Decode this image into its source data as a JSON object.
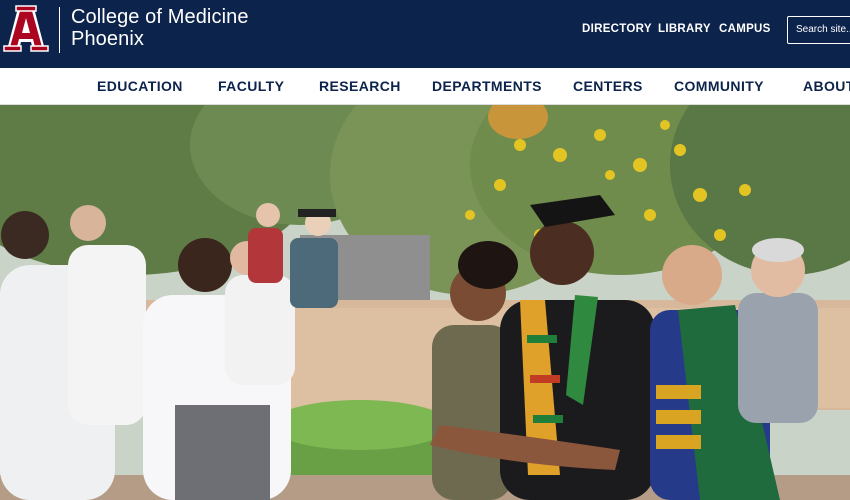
{
  "header": {
    "logo_letter": "A",
    "title_line1": "College of Medicine",
    "title_line2": "Phoenix",
    "util_links": [
      "DIRECTORY",
      "LIBRARY",
      "CAMPUS"
    ],
    "search_placeholder": "Search site..."
  },
  "nav": {
    "items": [
      "EDUCATION",
      "FACULTY",
      "RESEARCH",
      "DEPARTMENTS",
      "CENTERS",
      "COMMUNITY",
      "ABOUT"
    ]
  },
  "hero": {
    "description_icon": "graduation-photo"
  },
  "colors": {
    "brand_navy": "#0c234b",
    "brand_red": "#ab0520",
    "white": "#ffffff"
  }
}
